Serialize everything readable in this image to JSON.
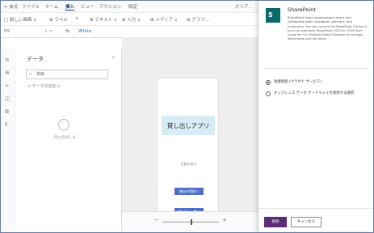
{
  "menubar": {
    "items": [
      "← 戻る",
      "ファイル",
      "ホーム",
      "挿入",
      "ビュー",
      "アクション",
      "設定"
    ],
    "active_index": 3,
    "right_label": "ボリア..."
  },
  "toolbar": {
    "items": [
      "□ 新しい画面 ∨",
      "⊞ ラベル",
      "∨",
      "⊞ テキスト ∨",
      "⊞ 入力 ∨",
      "⊞ メディア ∨",
      "⊞ グラフ..."
    ]
  },
  "formula": {
    "property": "Fill",
    "fx": "fx",
    "value": "White"
  },
  "data_panel": {
    "title": "データ",
    "close": "×",
    "search_placeholder": "検索",
    "add_data": "+ データの追加 ∨",
    "empty_text": "何か追加しま..."
  },
  "canvas": {
    "app_title": "貸し出しアプリ",
    "label_text": "全員を表示",
    "button1": "貸出を登録へ",
    "button2": "貸し出し一覧へ"
  },
  "zoombar": {
    "minus": "−",
    "plus": "+"
  },
  "dialog": {
    "logo_letter": "S",
    "title": "SharePoint",
    "description": "SharePoint helps organizations share and collaborate with colleagues, partners, and customers. You can connect to SharePoint Online or to an on-premises SharePoint 2013 or 2016 farm using the On-Premises Data Gateway to manage documents and list items.",
    "options": [
      "直接接続 (クラウド サービス)",
      "オンプレミス データ ゲートウェイを使用する接続"
    ],
    "selected_index": 0,
    "connect_label": "接続",
    "cancel_label": "キャンセル"
  },
  "colors": {
    "accent": "#5b2d79",
    "logo": "#0a6a6c",
    "app_header": "#d6ecf7",
    "canvas_button": "#4f6ec6"
  }
}
